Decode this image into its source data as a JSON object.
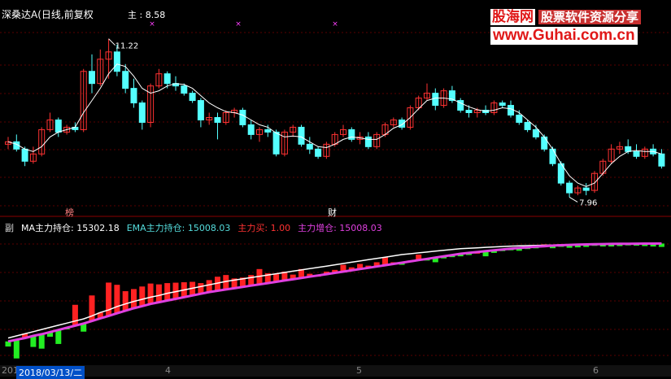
{
  "title": "深桑达A(日线,前复权",
  "main_label": "主 : 8.58",
  "high_marker": "11.22",
  "low_marker": "7.96",
  "event_marks": [
    "榜",
    "财"
  ],
  "sub_legend": {
    "prefix": "副",
    "ma_label": "MA主力持仓: 15302.18",
    "ema_label": "EMA主力持仓: 15008.03",
    "buy_label": "主力买: 1.00",
    "add_label": "主力增仓: 15008.03"
  },
  "logo": {
    "brand": "股海网",
    "slogan": "股票软件资源分享",
    "url": "www.Guhai.com.cn"
  },
  "date_cell": "2018/03/13/二",
  "axis_prefix": "201",
  "axis_months": [
    "4",
    "5",
    "6"
  ],
  "colors": {
    "up": "#ff3232",
    "down": "#54ffff",
    "ma_line": "#ffffff",
    "indicator_up": "#ff2222",
    "indicator_down": "#22ee22",
    "ema_line": "#e040e0",
    "ma_sub_line": "#ffffff",
    "grid": "#5a0000"
  },
  "chart_data": {
    "type": "candlestick",
    "candles": [
      [
        9.05,
        9.2,
        8.95,
        9.1
      ],
      [
        9.1,
        9.25,
        8.9,
        8.95
      ],
      [
        8.95,
        9.0,
        8.6,
        8.7
      ],
      [
        8.7,
        9.0,
        8.65,
        8.85
      ],
      [
        8.85,
        9.4,
        8.8,
        9.35
      ],
      [
        9.35,
        9.7,
        9.3,
        9.55
      ],
      [
        9.55,
        9.6,
        9.2,
        9.3
      ],
      [
        9.3,
        9.45,
        9.25,
        9.4
      ],
      [
        9.4,
        9.5,
        9.3,
        9.35
      ],
      [
        9.35,
        10.6,
        9.3,
        10.55
      ],
      [
        10.55,
        10.9,
        10.1,
        10.3
      ],
      [
        10.3,
        11.0,
        10.25,
        10.8
      ],
      [
        10.8,
        11.22,
        10.4,
        10.95
      ],
      [
        10.95,
        11.1,
        10.45,
        10.55
      ],
      [
        10.55,
        10.7,
        10.1,
        10.2
      ],
      [
        10.2,
        10.4,
        9.8,
        9.9
      ],
      [
        9.9,
        9.95,
        9.35,
        9.5
      ],
      [
        9.5,
        10.3,
        9.4,
        10.25
      ],
      [
        10.25,
        10.6,
        10.2,
        10.5
      ],
      [
        10.5,
        10.55,
        10.2,
        10.3
      ],
      [
        10.3,
        10.45,
        10.15,
        10.25
      ],
      [
        10.25,
        10.3,
        10.05,
        10.1
      ],
      [
        10.1,
        10.15,
        9.9,
        9.95
      ],
      [
        9.95,
        10.0,
        9.4,
        9.55
      ],
      [
        9.55,
        9.7,
        9.45,
        9.6
      ],
      [
        9.6,
        9.7,
        9.15,
        9.5
      ],
      [
        9.5,
        9.75,
        9.45,
        9.7
      ],
      [
        9.7,
        9.8,
        9.6,
        9.75
      ],
      [
        9.75,
        9.8,
        9.4,
        9.45
      ],
      [
        9.45,
        9.55,
        9.15,
        9.25
      ],
      [
        9.25,
        9.4,
        9.1,
        9.35
      ],
      [
        9.35,
        9.45,
        9.2,
        9.3
      ],
      [
        9.3,
        9.35,
        8.8,
        8.85
      ],
      [
        8.85,
        9.35,
        8.8,
        9.3
      ],
      [
        9.3,
        9.45,
        9.2,
        9.4
      ],
      [
        9.4,
        9.45,
        9.0,
        9.05
      ],
      [
        9.05,
        9.2,
        8.85,
        8.95
      ],
      [
        8.95,
        9.0,
        8.75,
        8.8
      ],
      [
        8.8,
        9.1,
        8.75,
        9.05
      ],
      [
        9.05,
        9.3,
        9.0,
        9.25
      ],
      [
        9.25,
        9.45,
        9.2,
        9.35
      ],
      [
        9.35,
        9.4,
        9.1,
        9.15
      ],
      [
        9.15,
        9.3,
        9.05,
        9.2
      ],
      [
        9.2,
        9.3,
        8.95,
        9.0
      ],
      [
        9.0,
        9.3,
        8.95,
        9.25
      ],
      [
        9.25,
        9.5,
        9.2,
        9.45
      ],
      [
        9.45,
        9.6,
        9.4,
        9.55
      ],
      [
        9.55,
        9.6,
        9.35,
        9.4
      ],
      [
        9.4,
        9.85,
        9.35,
        9.8
      ],
      [
        9.8,
        10.05,
        9.75,
        10.0
      ],
      [
        10.0,
        10.3,
        9.95,
        10.1
      ],
      [
        10.1,
        10.2,
        9.75,
        9.85
      ],
      [
        9.85,
        10.2,
        9.8,
        10.15
      ],
      [
        10.15,
        10.25,
        9.9,
        9.95
      ],
      [
        9.95,
        10.0,
        9.7,
        9.75
      ],
      [
        9.75,
        9.85,
        9.6,
        9.7
      ],
      [
        9.7,
        9.8,
        9.6,
        9.75
      ],
      [
        9.75,
        9.85,
        9.65,
        9.7
      ],
      [
        9.7,
        9.95,
        9.65,
        9.9
      ],
      [
        9.9,
        9.95,
        9.8,
        9.85
      ],
      [
        9.85,
        9.95,
        9.6,
        9.65
      ],
      [
        9.65,
        9.75,
        9.45,
        9.5
      ],
      [
        9.5,
        9.55,
        9.3,
        9.35
      ],
      [
        9.35,
        9.45,
        9.15,
        9.2
      ],
      [
        9.2,
        9.25,
        8.9,
        8.95
      ],
      [
        8.95,
        9.0,
        8.6,
        8.65
      ],
      [
        8.65,
        8.7,
        8.2,
        8.25
      ],
      [
        8.25,
        8.3,
        7.96,
        8.05
      ],
      [
        8.05,
        8.2,
        8.0,
        8.15
      ],
      [
        8.15,
        8.25,
        8.0,
        8.1
      ],
      [
        8.1,
        8.5,
        8.05,
        8.45
      ],
      [
        8.45,
        8.75,
        8.4,
        8.7
      ],
      [
        8.7,
        9.05,
        8.65,
        8.95
      ],
      [
        8.95,
        9.1,
        8.85,
        9.0
      ],
      [
        9.0,
        9.15,
        8.85,
        8.9
      ],
      [
        8.9,
        9.05,
        8.75,
        8.8
      ],
      [
        8.8,
        9.0,
        8.75,
        8.95
      ],
      [
        8.95,
        9.05,
        8.8,
        8.85
      ],
      [
        8.85,
        8.95,
        8.55,
        8.6
      ]
    ],
    "ma": [
      9.1,
      9.05,
      8.95,
      8.9,
      9.0,
      9.2,
      9.3,
      9.35,
      9.4,
      9.7,
      9.95,
      10.2,
      10.5,
      10.7,
      10.65,
      10.45,
      10.2,
      10.1,
      10.15,
      10.25,
      10.3,
      10.28,
      10.2,
      10.05,
      9.9,
      9.8,
      9.72,
      9.7,
      9.65,
      9.55,
      9.45,
      9.4,
      9.28,
      9.2,
      9.22,
      9.2,
      9.1,
      9.0,
      8.98,
      9.05,
      9.15,
      9.2,
      9.18,
      9.15,
      9.15,
      9.25,
      9.38,
      9.45,
      9.6,
      9.78,
      9.95,
      10.0,
      10.0,
      9.98,
      9.9,
      9.82,
      9.76,
      9.73,
      9.75,
      9.8,
      9.78,
      9.7,
      9.55,
      9.4,
      9.2,
      8.95,
      8.65,
      8.4,
      8.25,
      8.18,
      8.25,
      8.45,
      8.65,
      8.8,
      8.9,
      8.92,
      8.9,
      8.9,
      8.85
    ],
    "indicator": {
      "bars": [
        13700,
        13420,
        14000,
        13690,
        13650,
        13930,
        13760,
        14120,
        14680,
        14050,
        14900,
        14500,
        15202,
        15150,
        15000,
        15050,
        15110,
        15180,
        15160,
        15190,
        15200,
        15210,
        15220,
        15190,
        15260,
        15340,
        15380,
        15300,
        15320,
        15380,
        15520,
        15420,
        15400,
        15460,
        15390,
        15520,
        15410,
        15380,
        15460,
        15500,
        15620,
        15560,
        15640,
        15600,
        15680,
        15800,
        15680,
        15620,
        15720,
        15860,
        15720,
        15680,
        15770,
        15800,
        15820,
        15850,
        15920,
        15820,
        15900,
        15960,
        15960,
        15950,
        15990,
        16040,
        16100,
        16010,
        16050,
        16020,
        16030,
        16040,
        16080,
        16050,
        16050,
        16060,
        16080,
        16070,
        16060,
        16050,
        16040
      ],
      "ma_line": [
        13900,
        13950,
        14000,
        14050,
        14100,
        14150,
        14200,
        14250,
        14300,
        14350,
        14420,
        14500,
        14560,
        14640,
        14700,
        14760,
        14810,
        14860,
        14900,
        14950,
        14990,
        15030,
        15070,
        15110,
        15150,
        15190,
        15230,
        15260,
        15290,
        15320,
        15350,
        15380,
        15410,
        15440,
        15470,
        15500,
        15530,
        15560,
        15590,
        15620,
        15650,
        15680,
        15710,
        15740,
        15770,
        15800,
        15830,
        15860,
        15880,
        15900,
        15920,
        15940,
        15960,
        15980,
        16000,
        16010,
        16020,
        16030,
        16040,
        16050,
        16060,
        16065,
        16070,
        16075,
        16080,
        16085,
        16090,
        16095,
        16100,
        16105,
        16108,
        16110,
        16112,
        16114,
        16116,
        16118,
        16119,
        16120,
        16120
      ],
      "ema_line": [
        13820,
        13860,
        13900,
        13950,
        13990,
        14040,
        14090,
        14140,
        14190,
        14240,
        14300,
        14360,
        14420,
        14480,
        14540,
        14600,
        14650,
        14700,
        14740,
        14780,
        14820,
        14860,
        14900,
        14940,
        14980,
        15010,
        15040,
        15070,
        15100,
        15130,
        15160,
        15190,
        15220,
        15250,
        15280,
        15310,
        15340,
        15370,
        15400,
        15430,
        15460,
        15490,
        15520,
        15550,
        15580,
        15610,
        15640,
        15670,
        15700,
        15730,
        15760,
        15790,
        15820,
        15850,
        15880,
        15900,
        15920,
        15940,
        15960,
        15980,
        16000,
        16015,
        16030,
        16045,
        16058,
        16070,
        16080,
        16088,
        16095,
        16100,
        16104,
        16107,
        16110,
        16112,
        16114,
        16116,
        16118,
        16119,
        16120
      ]
    }
  }
}
